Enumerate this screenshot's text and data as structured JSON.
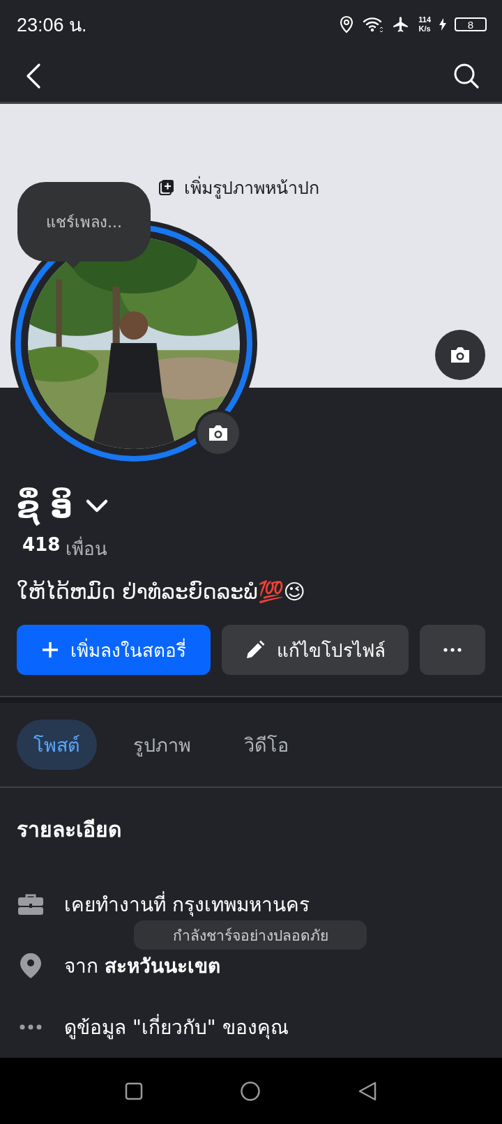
{
  "status_bar": {
    "time": "23:06 น.",
    "speed": "114",
    "speed_unit": "K/s",
    "battery": "8"
  },
  "cover": {
    "add_label": "เพิ่มรูปภาพหน้าปก"
  },
  "tooltip": "แชร์เพลง...",
  "profile": {
    "name": "ຊຶ່ ອິ",
    "friends_count": "418",
    "friends_label": "เพื่อน",
    "bio": "ໃຫ້ໄດ້ຫມົດ ຢ່າທໍລະຍົດລະພໍ💯😉"
  },
  "actions": [
    {
      "kind": "story",
      "label": "เพิ่มลงในสตอรี่"
    },
    {
      "kind": "edit",
      "label": "แก้ไขโปรไฟล์"
    },
    {
      "kind": "more"
    }
  ],
  "tabs": [
    {
      "label": "โพสต์",
      "selected": true
    },
    {
      "label": "รูปภาพ",
      "selected": false
    },
    {
      "label": "วิดีโอ",
      "selected": false
    }
  ],
  "details": {
    "title": "รายละเอียด",
    "items": [
      {
        "kind": "work",
        "text": "เคยทำงานที่ กรุงเทพมหานคร"
      },
      {
        "kind": "location",
        "text": "จาก **สะหวันนะเขต**"
      },
      {
        "kind": "more",
        "text": "ดูข้อมูล \"เกี่ยวกับ\" ของคุณ"
      }
    ]
  },
  "toast": "กำลังชาร์จอย่างปลอดภัย"
}
